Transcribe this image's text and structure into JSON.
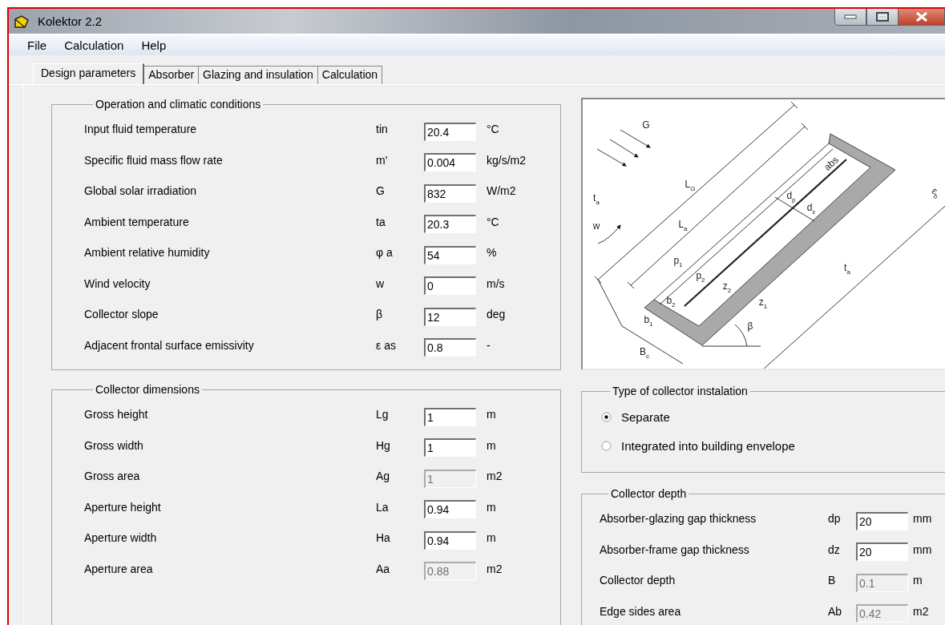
{
  "window": {
    "title": "Kolektor 2.2"
  },
  "menu": [
    "File",
    "Calculation",
    "Help"
  ],
  "tabs": [
    {
      "label": "Design parameters",
      "selected": true
    },
    {
      "label": "Absorber",
      "selected": false
    },
    {
      "label": "Glazing and insulation",
      "selected": false
    },
    {
      "label": "Calculation",
      "selected": false
    }
  ],
  "operation_conditions": {
    "title": "Operation and climatic conditions",
    "params": [
      {
        "label": "Input fluid temperature",
        "symbol": "tin",
        "value": "20.4",
        "unit": "°C",
        "disabled": false
      },
      {
        "label": "Specific fluid mass flow rate",
        "symbol": "m'",
        "value": "0.004",
        "unit": "kg/s/m2",
        "disabled": false
      },
      {
        "label": "Global solar irradiation",
        "symbol": "G",
        "value": "832",
        "unit": "W/m2",
        "disabled": false
      },
      {
        "label": "Ambient temperature",
        "symbol": "ta",
        "value": "20.3",
        "unit": "°C",
        "disabled": false
      },
      {
        "label": "Ambient relative humidity",
        "symbol": "φ a",
        "value": "54",
        "unit": "%",
        "disabled": false
      },
      {
        "label": "Wind velocity",
        "symbol": "w",
        "value": "0",
        "unit": "m/s",
        "disabled": false
      },
      {
        "label": "Collector slope",
        "symbol": "β",
        "value": "12",
        "unit": "deg",
        "disabled": false
      },
      {
        "label": "Adjacent frontal surface emissivity",
        "symbol": "ε as",
        "value": "0.8",
        "unit": "-",
        "disabled": false
      }
    ]
  },
  "diagram": {
    "labels": [
      "G",
      "L$_{G}$",
      "t$_{a}$",
      "w",
      "L$_{a}$",
      "p$_{1}$",
      "p$_{2}$",
      "z$_{2}$",
      "b$_{2}$",
      "b$_{1}$",
      "B$_{c}$",
      "z$_{1}$",
      "β",
      "d$_{p}$",
      "d$_{z}$",
      "abs",
      "ε$_{b}$",
      "t$_{a}$"
    ]
  },
  "collector_dimensions": {
    "title": "Collector dimensions",
    "params": [
      {
        "label": "Gross height",
        "symbol": "Lg",
        "value": "1",
        "unit": "m",
        "disabled": false
      },
      {
        "label": "Gross width",
        "symbol": "Hg",
        "value": "1",
        "unit": "m",
        "disabled": false
      },
      {
        "label": "Gross area",
        "symbol": "Ag",
        "value": "1",
        "unit": "m2",
        "disabled": true
      },
      {
        "label": "Aperture height",
        "symbol": "La",
        "value": "0.94",
        "unit": "m",
        "disabled": false
      },
      {
        "label": "Aperture width",
        "symbol": "Ha",
        "value": "0.94",
        "unit": "m",
        "disabled": false
      },
      {
        "label": "Aperture area",
        "symbol": "Aa",
        "value": "0.88",
        "unit": "m2",
        "disabled": true
      }
    ]
  },
  "installation_type": {
    "title": "Type of collector instalation",
    "options": [
      {
        "label": "Separate",
        "selected": true
      },
      {
        "label": "Integrated into building envelope",
        "selected": false
      }
    ]
  },
  "collector_depth": {
    "title": "Collector depth",
    "params": [
      {
        "label": "Absorber-glazing gap thickness",
        "symbol": "dp",
        "value": "20",
        "unit": "mm",
        "disabled": false
      },
      {
        "label": "Absorber-frame gap thickness",
        "symbol": "dz",
        "value": "20",
        "unit": "mm",
        "disabled": false
      },
      {
        "label": "Collector depth",
        "symbol": "B",
        "value": "0.1",
        "unit": "m",
        "disabled": true
      },
      {
        "label": "Edge sides area",
        "symbol": "Ab",
        "value": "0.42",
        "unit": "m2",
        "disabled": true
      }
    ]
  }
}
